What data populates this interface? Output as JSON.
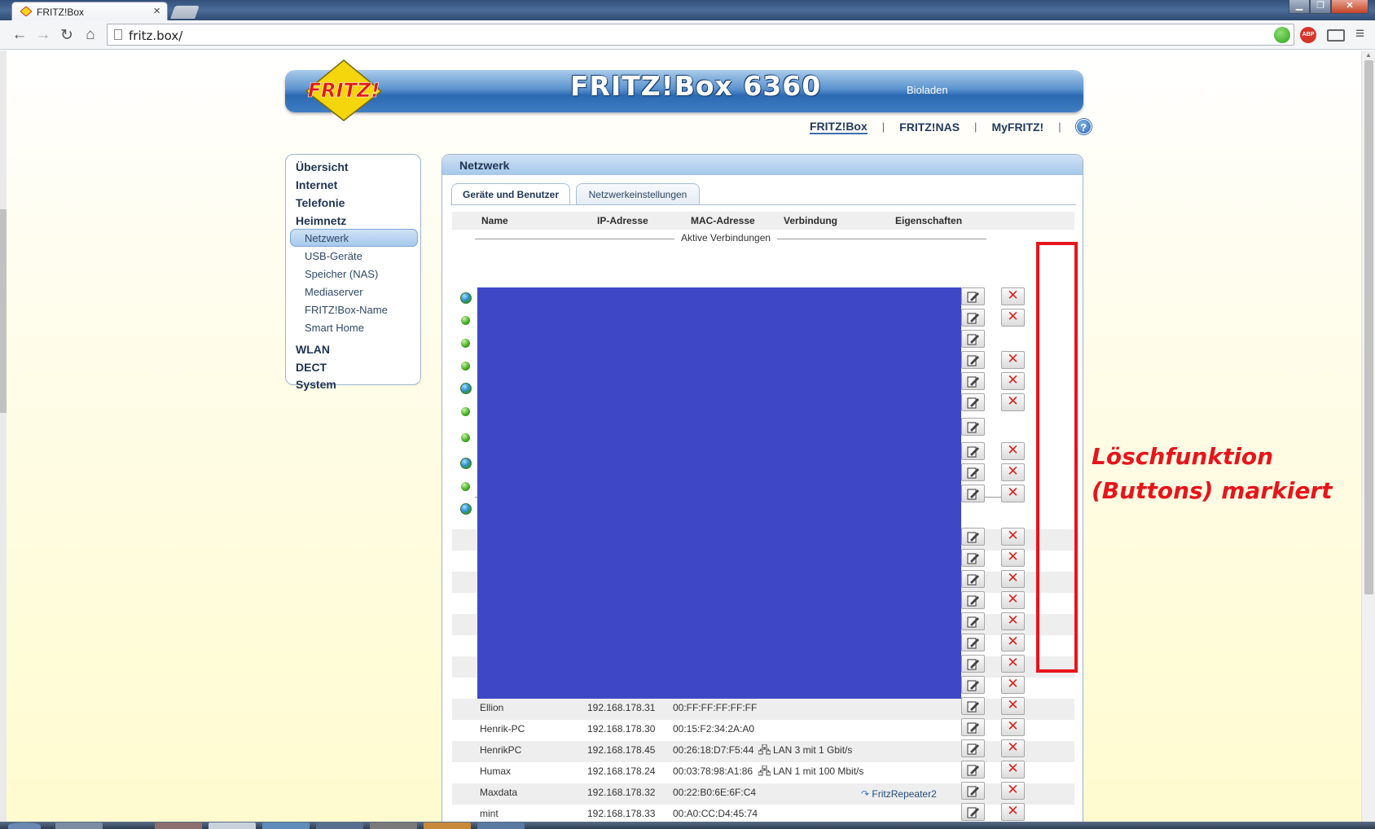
{
  "browser": {
    "tab_title": "FRITZ!Box",
    "tab_close": "×",
    "url": "fritz.box/",
    "window_min": "▁",
    "window_max": "❐",
    "window_close": "✕",
    "back_icon": "←",
    "forward_icon": "→",
    "reload_icon": "↻",
    "home_icon": "⌂",
    "star_icon": "☆",
    "abp_label": "ABP",
    "menu_icon": "≡"
  },
  "header": {
    "logo_text": "FRITZ!",
    "product_name": "FRITZ!Box 6360",
    "box_name": "Bioladen"
  },
  "topnav": {
    "items": [
      "FRITZ!Box",
      "FRITZ!NAS",
      "MyFRITZ!"
    ],
    "separator": "|",
    "help": "?"
  },
  "menu": {
    "top_items": [
      "Übersicht",
      "Internet",
      "Telefonie",
      "Heimnetz",
      "WLAN",
      "DECT",
      "System"
    ],
    "sub_items": [
      "Netzwerk",
      "USB-Geräte",
      "Speicher (NAS)",
      "Mediaserver",
      "FRITZ!Box-Name",
      "Smart Home"
    ],
    "active_sub": "Netzwerk"
  },
  "panel": {
    "title": "Netzwerk",
    "tabs": [
      "Geräte und Benutzer",
      "Netzwerkeinstellungen"
    ],
    "active_tab": "Geräte und Benutzer",
    "columns": [
      "Name",
      "IP-Adresse",
      "MAC-Adresse",
      "Verbindung",
      "Eigenschaften"
    ],
    "section_active": "Aktive Verbindungen",
    "delete_symbol": "✕"
  },
  "devices": [
    {
      "name": "Ellion",
      "ip": "192.168.178.31",
      "mac": "00:FF:FF:FF:FF:FF",
      "connection": "",
      "properties": ""
    },
    {
      "name": "Henrik-PC",
      "ip": "192.168.178.30",
      "mac": "00:15:F2:34:2A:A0",
      "connection": "",
      "properties": ""
    },
    {
      "name": "HenrikPC",
      "ip": "192.168.178.45",
      "mac": "00:26:18:D7:F5:44",
      "connection": "LAN 3 mit 1 Gbit/s",
      "properties": ""
    },
    {
      "name": "Humax",
      "ip": "192.168.178.24",
      "mac": "00:03:78:98:A1:86",
      "connection": "LAN 1 mit 100 Mbit/s",
      "properties": ""
    },
    {
      "name": "Maxdata",
      "ip": "192.168.178.32",
      "mac": "00:22:B0:6E:6F:C4",
      "connection": "",
      "properties": "FritzRepeater2"
    },
    {
      "name": "mint",
      "ip": "192.168.178.33",
      "mac": "00:A0:CC:D4:45:74",
      "connection": "",
      "properties": ""
    }
  ],
  "annotation": {
    "line1": "Löschfunktion",
    "line2": "(Buttons) markiert",
    "color": "#e8141b"
  },
  "colors": {
    "header_blue": "#2c69b1",
    "redaction": "#3e48c7",
    "delete_red": "#d9231c"
  }
}
